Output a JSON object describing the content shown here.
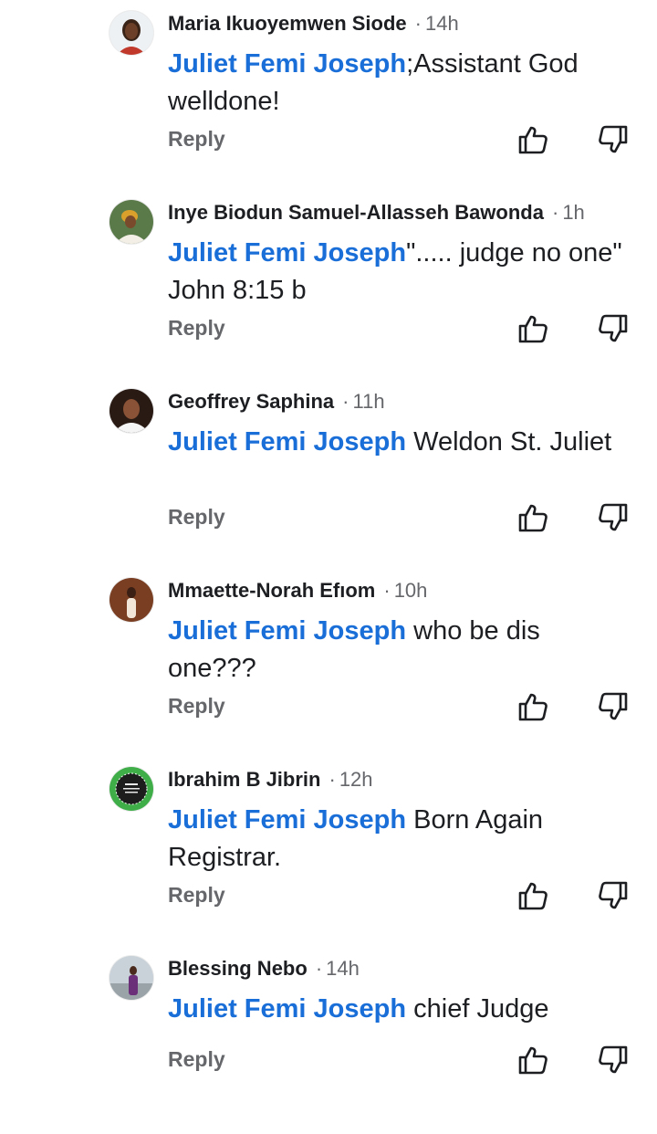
{
  "colors": {
    "mention": "#1a6ed8",
    "meta_gray": "#65676b",
    "text": "#1c1e21"
  },
  "comments": [
    {
      "author": "Maria Ikuoyemwen Siode",
      "time": "14h",
      "mention": "Juliet Femi Joseph",
      "text": ";Assistant God welldone!",
      "reply_label": "Reply",
      "avatar_icon": "avatar-woman-icon"
    },
    {
      "author": "Inye Biodun Samuel-Allasseh Bawonda",
      "time": "1h",
      "mention": "Juliet Femi Joseph",
      "text": "\"..... judge no one\" John 8:15 b",
      "reply_label": "Reply",
      "avatar_icon": "avatar-woman-icon"
    },
    {
      "author": "Geoffrey Saphina",
      "time": "11h",
      "mention": "Juliet Femi Joseph",
      "text": " Weldon St. Juliet",
      "reply_label": "Reply",
      "avatar_icon": "avatar-man-icon"
    },
    {
      "author": "Mmaette-Norah Efıom",
      "time": "10h",
      "mention": "Juliet Femi Joseph",
      "text": " who be dis one???",
      "reply_label": "Reply",
      "avatar_icon": "avatar-woman-icon"
    },
    {
      "author": "Ibrahim B Jibrin",
      "time": "12h",
      "mention": "Juliet Femi Joseph",
      "text": " Born Again Registrar.",
      "reply_label": "Reply",
      "avatar_icon": "avatar-logo-icon"
    },
    {
      "author": "Blessing Nebo",
      "time": "14h",
      "mention": "Juliet Femi Joseph",
      "text": " chief Judge",
      "reply_label": "Reply",
      "avatar_icon": "avatar-woman-icon"
    }
  ],
  "separator": "·"
}
